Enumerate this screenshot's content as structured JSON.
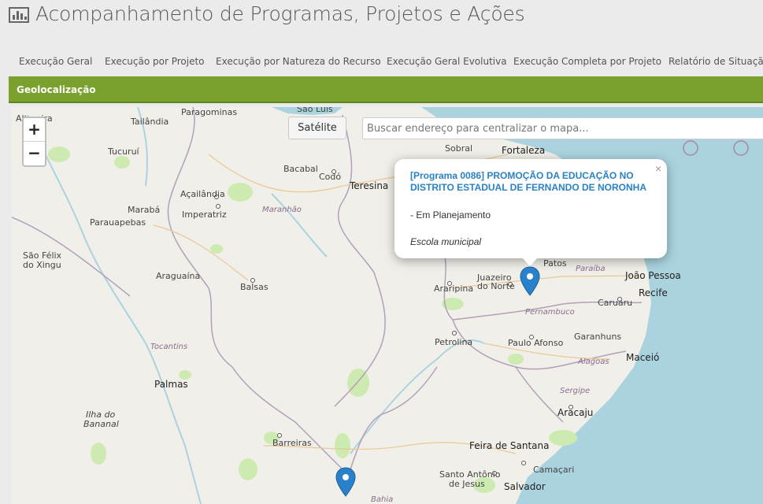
{
  "header": {
    "title": "Acompanhamento de Programas, Projetos e Ações",
    "icon": "bar-chart-icon"
  },
  "tabs": [
    "Execução Geral",
    "Execução por Projeto",
    "Execução por Natureza do Recurso",
    "Execução Geral Evolutiva",
    "Execução Completa por Projeto",
    "Relatório de Situação"
  ],
  "section": {
    "title": "Geolocalização"
  },
  "map": {
    "zoom_in": "+",
    "zoom_out": "−",
    "satellite_button": "Satélite",
    "search_placeholder": "Buscar endereço para centralizar o mapa...",
    "popup": {
      "title": "[Programa 0086] PROMOÇÃO DA EDUCAÇÃO NO DISTRITO ESTADUAL DE FERNANDO DE NORONHA",
      "status": "- Em Planejamento",
      "type": "Escola municipal",
      "close": "×"
    },
    "cities": {
      "sao_luis": "São Luís",
      "paragominas": "Paragominas",
      "tailandia": "Tailândia",
      "tucurui": "Tucuruí",
      "bacabal": "Bacabal",
      "codo": "Codó",
      "teresina": "Teresina",
      "acailandia": "Açailândia",
      "maraba": "Marabá",
      "imperatriz": "Imperatriz",
      "parauapebas": "Parauapebas",
      "sao_felix": "São Félix",
      "do_xingu": "do Xingu",
      "araguaina": "Araguaína",
      "balsas": "Balsas",
      "sobral": "Sobral",
      "fortaleza": "Fortaleza",
      "patos": "Patos",
      "joao_pessoa": "João Pessoa",
      "juazeiro": "Juazeiro",
      "do_norte": "do Norte",
      "araripina": "Araripina",
      "recife": "Recife",
      "caruaru": "Caruaru",
      "petrolina": "Petrolina",
      "paulo_afonso": "Paulo Afonso",
      "garanhuns": "Garanhuns",
      "maceio": "Maceió",
      "palmas": "Palmas",
      "aracaju": "Aracaju",
      "ilha": "Ilha do",
      "bananal": "Bananal",
      "barreiras": "Barreiras",
      "feira": "Feira de Santana",
      "camacari": "Camaçari",
      "santo_antonio": "Santo Antônio",
      "de_jesus": "de Jesus",
      "salvador": "Salvador",
      "altamira": "Altamira"
    },
    "states": {
      "maranhao": "Maranhão",
      "tocantins": "Tocantins",
      "paraiba": "Paraíba",
      "pernambuco": "Pernambuco",
      "alagoas": "Alagoas",
      "sergipe": "Sergipe",
      "bahia": "Bahia"
    },
    "colors": {
      "water": "#aad3df",
      "land": "#f1efe9",
      "green": "#cdebb0",
      "marker": "#2a81cb"
    }
  }
}
